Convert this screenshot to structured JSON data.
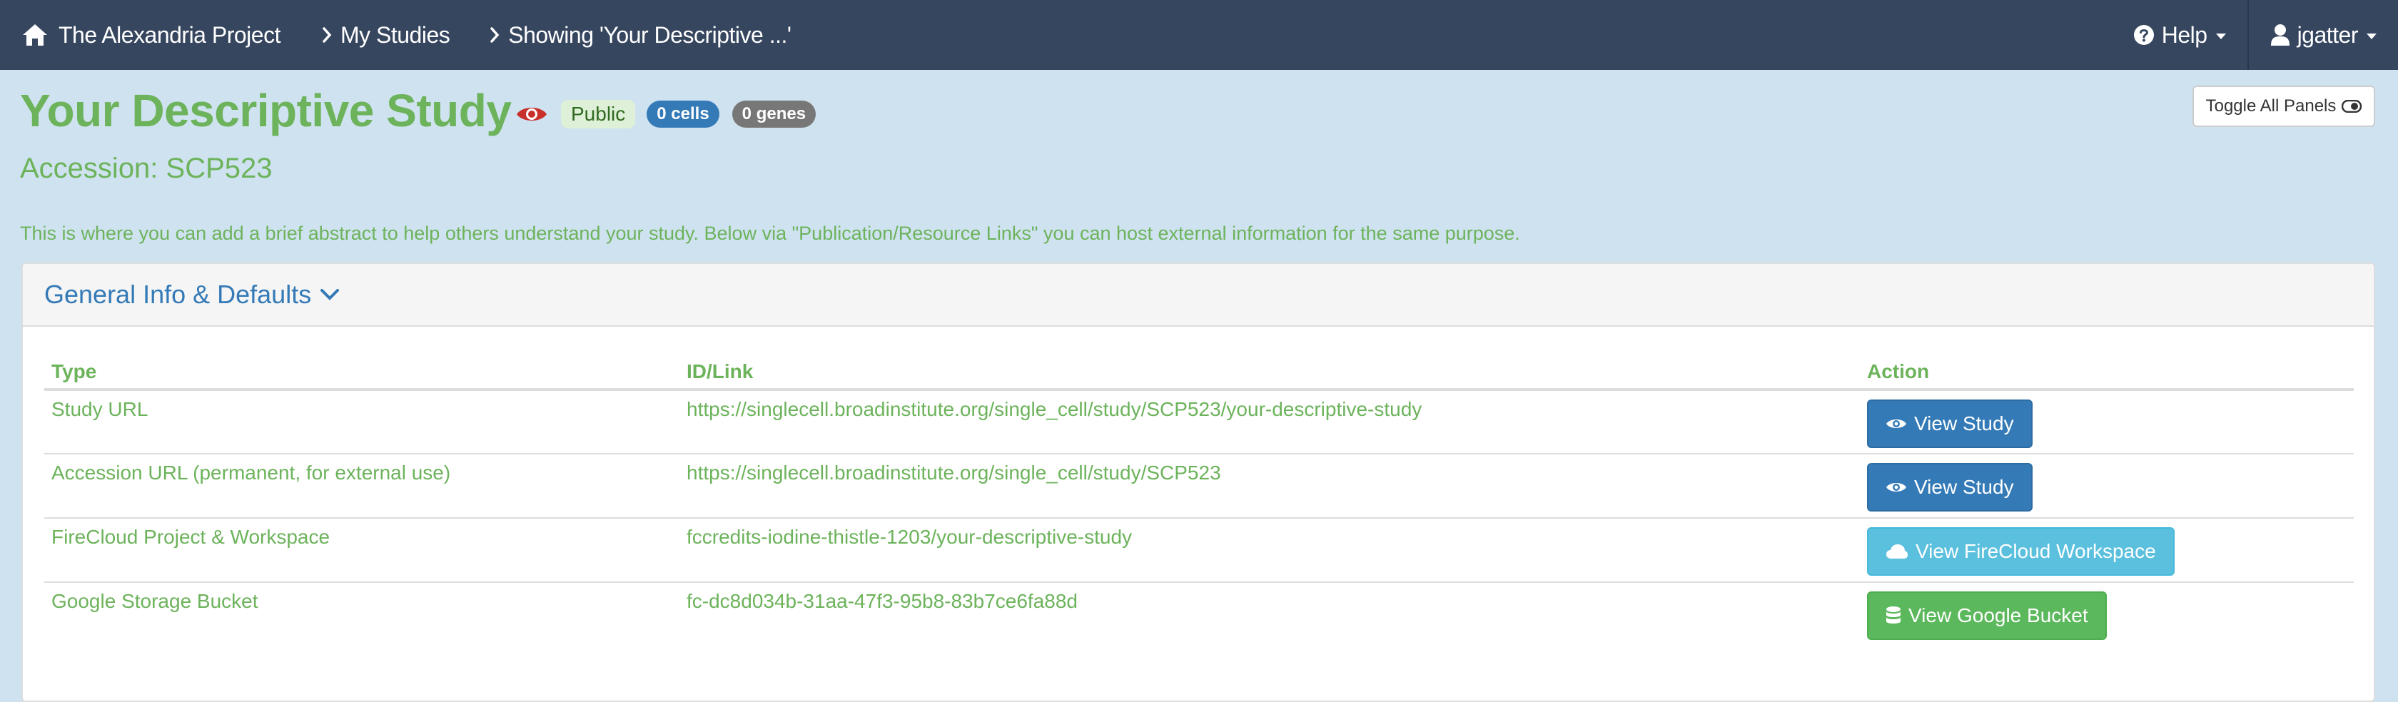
{
  "nav": {
    "brand": "The Alexandria Project",
    "breadcrumbs": [
      "My Studies",
      "Showing 'Your Descriptive ...'"
    ],
    "help": "Help",
    "user": "jgatter"
  },
  "header": {
    "title": "Your Descriptive Study",
    "visibility": "Public",
    "cells_badge": "0 cells",
    "genes_badge": "0 genes",
    "toggle_panels": "Toggle All Panels",
    "accession": "Accession: SCP523",
    "abstract": "This is where you can add a brief abstract to help others understand your study. Below via \"Publication/Resource Links\" you can host external information for the same purpose."
  },
  "panel": {
    "title": "General Info & Defaults",
    "columns": [
      "Type",
      "ID/Link",
      "Action"
    ],
    "rows": [
      {
        "type": "Study URL",
        "id": "https://singlecell.broadinstitute.org/single_cell/study/SCP523/your-descriptive-study",
        "action": "View Study"
      },
      {
        "type": "Accession URL (permanent, for external use)",
        "id": "https://singlecell.broadinstitute.org/single_cell/study/SCP523",
        "action": "View Study"
      },
      {
        "type": "FireCloud Project & Workspace",
        "id": "fccredits-iodine-thistle-1203/your-descriptive-study",
        "action": "View FireCloud Workspace"
      },
      {
        "type": "Google Storage Bucket",
        "id": "fc-dc8d034b-31aa-47f3-95b8-83b7ce6fa88d",
        "action": "View Google Bucket"
      }
    ]
  },
  "icons": {
    "brand": "home-icon",
    "breadcrumb": "chevron-right-icon",
    "help": "question-circle-icon",
    "user": "user-icon",
    "visibility": "eye-icon",
    "toggle": "toggle-icon",
    "panel": "chevron-down-icon",
    "view_study": "eye-icon",
    "firecloud": "cloud-icon",
    "bucket": "database-icon"
  },
  "colors": {
    "navbar": "#36465f",
    "page_bg": "#cfe2ef",
    "accent_green": "#6cb35b",
    "link_blue": "#337ab7",
    "info": "#5bc0de",
    "success": "#5cb85c",
    "visibility_icon": "#c9302c"
  }
}
